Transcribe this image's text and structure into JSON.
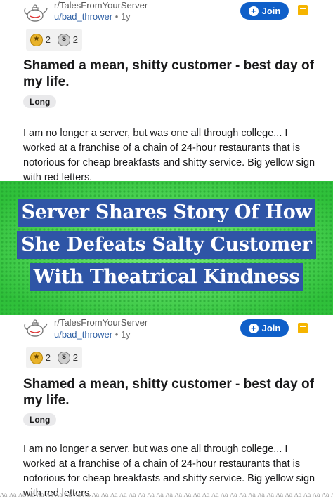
{
  "post": {
    "subreddit": "r/TalesFromYourServer",
    "user": "u/bad_thrower",
    "separator": "•",
    "time_ago": "1y",
    "join_label": "Join",
    "join_plus": "+",
    "awards": [
      {
        "icon": "gold-award-icon",
        "count": "2"
      },
      {
        "icon": "silver-award-icon",
        "count": "2"
      }
    ],
    "title": "Shamed a mean, shitty customer - best day of my life.",
    "flair": "Long",
    "body": "I am no longer a server, but was one all through college... I worked at a franchise of a chain of 24-hour restaurants that is notorious for cheap breakfasts and shitty service. Big yellow sign with red letters."
  },
  "banner": {
    "line1": "Server Shares Story Of How",
    "line2": "She Defeats Salty Customer",
    "line3": "With Theatrical Kindness",
    "bg_color": "#3dd649",
    "box_color": "#2f55a6"
  },
  "watermark": "Aa Aa Aa Aa Aa Aa Aa Aa Aa Aa Aa Aa Aa Aa Aa Aa Aa Aa Aa Aa Aa Aa Aa Aa Aa Aa Aa Aa Aa Aa Aa Aa Aa Aa Aa Aa Aa Aa"
}
